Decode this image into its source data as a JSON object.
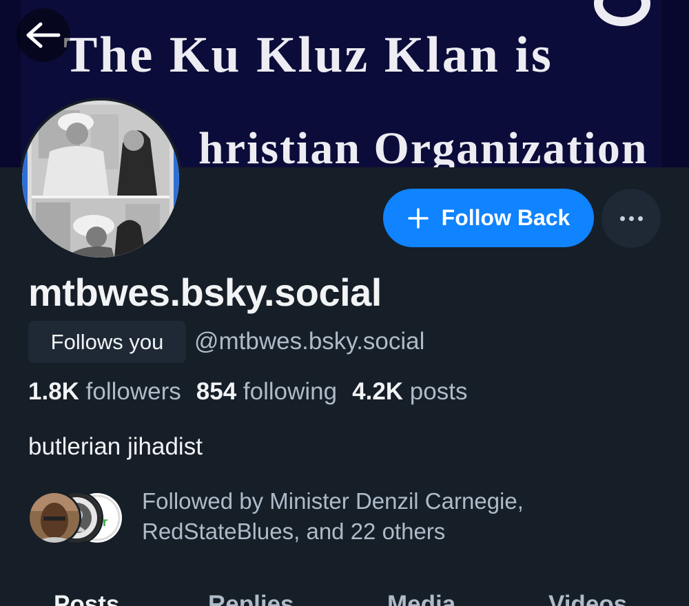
{
  "banner": {
    "line1": "The Ku Kluz Klan is",
    "line2": "hristian Organization"
  },
  "nav": {
    "back_icon": "arrow-left-icon"
  },
  "actions": {
    "follow_back_label": "Follow Back",
    "follow_icon": "plus-icon",
    "more_icon": "ellipsis-icon",
    "accent": "#1083fe"
  },
  "profile": {
    "display_name": "mtbwes.bsky.social",
    "follows_you": "Follows you",
    "handle": "@mtbwes.bsky.social",
    "bio": "butlerian jihadist"
  },
  "stats": {
    "followers_count": "1.8K",
    "followers_label": "followers",
    "following_count": "854",
    "following_label": "following",
    "posts_count": "4.2K",
    "posts_label": "posts"
  },
  "followed_by": {
    "line1": "Followed by Minister Denzil Carnegie,",
    "line2": "RedStateBlues, and 22 others"
  },
  "tabs": [
    {
      "label": "Posts",
      "active": true
    },
    {
      "label": "Replies",
      "active": false
    },
    {
      "label": "Media",
      "active": false
    },
    {
      "label": "Videos",
      "active": false
    }
  ]
}
